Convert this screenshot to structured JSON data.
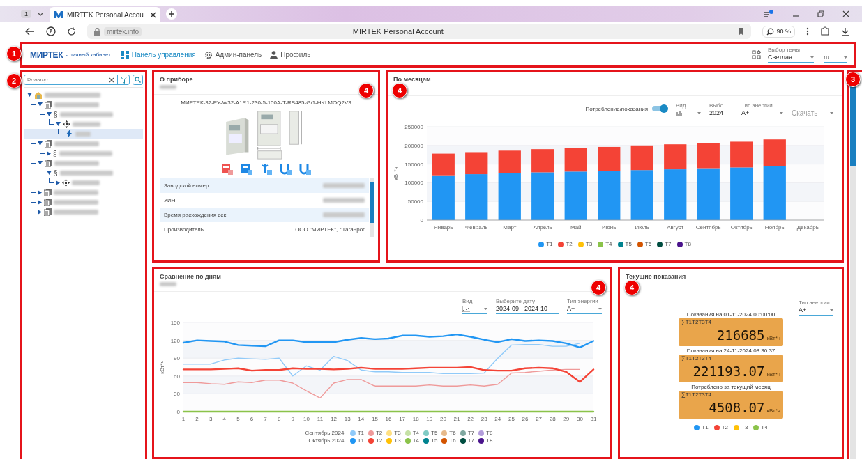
{
  "browser": {
    "tab_count": "1",
    "tab_title": "MIRTEK Personal Accou",
    "address": "mirtek.info",
    "page_title": "MIRTEK Personal Account",
    "zoom": "90 %"
  },
  "header": {
    "badge": "1",
    "logo": "МИРТЕК",
    "logo_tagline": "- личный кабинет",
    "nav": [
      {
        "label": "Панель управления",
        "selected": true
      },
      {
        "label": "Админ-панель",
        "selected": false
      },
      {
        "label": "Профиль",
        "selected": false
      }
    ],
    "theme": {
      "label": "Выбор темы",
      "value": "Светлая"
    },
    "language": {
      "value": "ru"
    }
  },
  "sidebar": {
    "badge": "2",
    "filter": {
      "placeholder": "Фильтр"
    },
    "tree": [
      {
        "kind": "building",
        "expanded": true,
        "selected": false,
        "children": [
          {
            "kind": "contract",
            "expanded": true,
            "selected": false,
            "children": [
              {
                "kind": "section",
                "symbol": "§",
                "expanded": true,
                "selected": false,
                "children": [
                  {
                    "kind": "point",
                    "expanded": true,
                    "selected": false,
                    "children": [
                      {
                        "kind": "meter",
                        "selected": true
                      }
                    ]
                  }
                ]
              }
            ]
          },
          {
            "kind": "contract",
            "expanded": true,
            "selected": false,
            "children": [
              {
                "kind": "section",
                "symbol": "§",
                "expanded": false,
                "selected": false
              }
            ]
          },
          {
            "kind": "contract",
            "expanded": true,
            "selected": false,
            "children": [
              {
                "kind": "section",
                "symbol": "§",
                "expanded": true,
                "selected": false,
                "children": [
                  {
                    "kind": "point",
                    "expanded": false,
                    "selected": false
                  }
                ]
              }
            ]
          },
          {
            "kind": "contract",
            "expanded": false,
            "selected": false
          },
          {
            "kind": "contract",
            "expanded": false,
            "selected": false
          },
          {
            "kind": "contract",
            "expanded": false,
            "selected": false
          }
        ]
      }
    ]
  },
  "scroll_region": {
    "badge": "3"
  },
  "device_card": {
    "badge": "4",
    "title": "О приборе",
    "model": "МИРТЕК-32-РУ-W32-A1R1-230-5-100A-T-RS485-G/1-HKLMOQ2V3",
    "properties": [
      {
        "label": "Заводской номер"
      },
      {
        "label": "УИН"
      },
      {
        "label": "Время расхождения сек."
      },
      {
        "label": "Производитель",
        "value": "ООО \"МИРТЕК\", г.Таганрог"
      }
    ]
  },
  "monthly_card": {
    "badge": "4",
    "title": "По месяцам",
    "controls": [
      {
        "kind": "toggle",
        "label": "Потребление/показания",
        "on": true
      },
      {
        "kind": "view",
        "label": "Вид"
      },
      {
        "kind": "input",
        "label": "Выбо...",
        "value": "2024"
      },
      {
        "kind": "select",
        "label": "Тип энергии",
        "value": "A+"
      },
      {
        "kind": "select",
        "placeholder": "Скачать"
      }
    ],
    "chart_data": {
      "type": "bar",
      "stacked": true,
      "grid": true,
      "ylabel": "кВт*ч",
      "categories": [
        "Январь",
        "Февраль",
        "Март",
        "Апрель",
        "Май",
        "Июнь",
        "Июль",
        "Август",
        "Сентябрь",
        "Октябрь",
        "Ноябрь",
        "Декабрь"
      ],
      "ylim": [
        0,
        250000
      ],
      "yticks": [
        0,
        50000,
        100000,
        150000,
        200000,
        250000
      ],
      "series": [
        {
          "name": "T1",
          "color": "#2196f3",
          "values": [
            120000,
            123000,
            126000,
            128000,
            130000,
            132000,
            134000,
            136000,
            139000,
            141000,
            145000,
            null
          ]
        },
        {
          "name": "T2",
          "color": "#f44336",
          "values": [
            58000,
            59000,
            60000,
            62000,
            63000,
            64000,
            66000,
            67000,
            67000,
            69000,
            71000,
            null
          ]
        },
        {
          "name": "T3",
          "color": "#ffc107",
          "values": [
            null,
            null,
            null,
            null,
            null,
            null,
            null,
            null,
            null,
            null,
            null,
            null
          ]
        },
        {
          "name": "T4",
          "color": "#8bc34a",
          "values": [
            null,
            null,
            null,
            null,
            null,
            null,
            null,
            null,
            null,
            null,
            null,
            null
          ]
        },
        {
          "name": "T5",
          "color": "#00838f",
          "values": [
            null,
            null,
            null,
            null,
            null,
            null,
            null,
            null,
            null,
            null,
            null,
            null
          ]
        },
        {
          "name": "T6",
          "color": "#d35400",
          "values": [
            null,
            null,
            null,
            null,
            null,
            null,
            null,
            null,
            null,
            null,
            null,
            null
          ]
        },
        {
          "name": "T7",
          "color": "#004d40",
          "values": [
            null,
            null,
            null,
            null,
            null,
            null,
            null,
            null,
            null,
            null,
            null,
            null
          ]
        },
        {
          "name": "T8",
          "color": "#4a148c",
          "values": [
            null,
            null,
            null,
            null,
            null,
            null,
            null,
            null,
            null,
            null,
            null,
            null
          ]
        }
      ]
    }
  },
  "daily_card": {
    "badge": "4",
    "title": "Сравнение по дням",
    "controls": [
      {
        "kind": "view",
        "label": "Вид"
      },
      {
        "kind": "input",
        "label": "Выберите дату",
        "value": "2024-09 - 2024-10"
      },
      {
        "kind": "select",
        "label": "Тип энергии",
        "value": "A+"
      }
    ],
    "legend_groups": [
      "Сентябрь 2024:",
      "Октябрь 2024:"
    ],
    "chart_data": {
      "type": "line",
      "grid": true,
      "ylabel": "кВт*ч",
      "x": [
        1,
        2,
        3,
        4,
        5,
        6,
        7,
        8,
        9,
        10,
        11,
        12,
        13,
        14,
        15,
        16,
        17,
        18,
        19,
        20,
        21,
        22,
        23,
        24,
        25,
        26,
        27,
        28,
        29,
        30,
        31
      ],
      "xlim": [
        1,
        31
      ],
      "xticks": [
        1,
        2,
        3,
        4,
        5,
        6,
        7,
        8,
        9,
        10,
        11,
        12,
        13,
        14,
        15,
        16,
        17,
        18,
        19,
        20,
        21,
        22,
        23,
        24,
        25,
        26,
        27,
        28,
        29,
        30,
        31
      ],
      "ylim": [
        0,
        150
      ],
      "yticks": [
        0,
        30,
        60,
        90,
        120,
        150
      ],
      "series": [
        {
          "name": "T1",
          "color": "#90caf9",
          "values": [
            80,
            80,
            80,
            87,
            90,
            89,
            88,
            90,
            60,
            77,
            70,
            93,
            86,
            70,
            67,
            67,
            66,
            66,
            66,
            64,
            64,
            64,
            65,
            90,
            112,
            113,
            113,
            110,
            110,
            115,
            null
          ]
        },
        {
          "name": "T2",
          "color": "#ef9a9a",
          "values": [
            49,
            49,
            47,
            46,
            50,
            49,
            53,
            53,
            48,
            35,
            23,
            48,
            54,
            54,
            43,
            43,
            43,
            43,
            45,
            43,
            43,
            45,
            43,
            46,
            65,
            66,
            68,
            70,
            71,
            71,
            null
          ]
        },
        {
          "name": "T3",
          "color": "#ffe082",
          "values": [
            null,
            null,
            null,
            null,
            null,
            null,
            null,
            null,
            null,
            null,
            null,
            null,
            null,
            null,
            null,
            null,
            null,
            null,
            null,
            null,
            null,
            null,
            null,
            null,
            null,
            null,
            null,
            null,
            null,
            null,
            null
          ]
        },
        {
          "name": "T4",
          "color": "#c5e1a5",
          "values": [
            null,
            null,
            null,
            null,
            null,
            null,
            null,
            null,
            null,
            null,
            null,
            null,
            null,
            null,
            null,
            null,
            null,
            null,
            null,
            null,
            null,
            null,
            null,
            null,
            null,
            null,
            null,
            null,
            null,
            null,
            null
          ]
        },
        {
          "name": "T5",
          "color": "#80cbc4",
          "values": [
            null,
            null,
            null,
            null,
            null,
            null,
            null,
            null,
            null,
            null,
            null,
            null,
            null,
            null,
            null,
            null,
            null,
            null,
            null,
            null,
            null,
            null,
            null,
            null,
            null,
            null,
            null,
            null,
            null,
            null,
            null
          ]
        },
        {
          "name": "T6",
          "color": "#e6b98a",
          "values": [
            null,
            null,
            null,
            null,
            null,
            null,
            null,
            null,
            null,
            null,
            null,
            null,
            null,
            null,
            null,
            null,
            null,
            null,
            null,
            null,
            null,
            null,
            null,
            null,
            null,
            null,
            null,
            null,
            null,
            null,
            null
          ]
        },
        {
          "name": "T7",
          "color": "#80a8a0",
          "values": [
            null,
            null,
            null,
            null,
            null,
            null,
            null,
            null,
            null,
            null,
            null,
            null,
            null,
            null,
            null,
            null,
            null,
            null,
            null,
            null,
            null,
            null,
            null,
            null,
            null,
            null,
            null,
            null,
            null,
            null,
            null
          ]
        },
        {
          "name": "T8",
          "color": "#b39ddb",
          "values": [
            null,
            null,
            null,
            null,
            null,
            null,
            null,
            null,
            null,
            null,
            null,
            null,
            null,
            null,
            null,
            null,
            null,
            null,
            null,
            null,
            null,
            null,
            null,
            null,
            null,
            null,
            null,
            null,
            null,
            null,
            null
          ]
        },
        {
          "name": "T1",
          "color": "#2196f3",
          "values": [
            116,
            120,
            119,
            118,
            112,
            111,
            110,
            120,
            120,
            117,
            117,
            117,
            121,
            124,
            122,
            123,
            128,
            128,
            126,
            127,
            130,
            126,
            121,
            117,
            122,
            119,
            120,
            119,
            115,
            108,
            119
          ]
        },
        {
          "name": "T2",
          "color": "#f44336",
          "values": [
            71,
            71,
            71,
            72,
            73,
            69,
            70,
            70,
            73,
            72,
            72,
            71,
            72,
            74,
            72,
            72,
            72,
            73,
            74,
            74,
            74,
            75,
            70,
            69,
            69,
            73,
            74,
            73,
            67,
            50,
            71
          ]
        },
        {
          "name": "T3",
          "color": "#ffc107",
          "values": [
            null,
            null,
            null,
            null,
            null,
            null,
            null,
            null,
            null,
            null,
            null,
            null,
            null,
            null,
            null,
            null,
            null,
            null,
            null,
            null,
            null,
            null,
            null,
            null,
            null,
            null,
            null,
            null,
            null,
            null,
            null
          ]
        },
        {
          "name": "T4",
          "color": "#8bc34a",
          "values": [
            0,
            0,
            0,
            0,
            0,
            0,
            0,
            0,
            0,
            0,
            0,
            0,
            0,
            0,
            0,
            0,
            0,
            0,
            0,
            0,
            0,
            0,
            0,
            0,
            0,
            0,
            0,
            0,
            0,
            0,
            0
          ]
        },
        {
          "name": "T5",
          "color": "#00838f",
          "values": [
            null,
            null,
            null,
            null,
            null,
            null,
            null,
            null,
            null,
            null,
            null,
            null,
            null,
            null,
            null,
            null,
            null,
            null,
            null,
            null,
            null,
            null,
            null,
            null,
            null,
            null,
            null,
            null,
            null,
            null,
            null
          ]
        },
        {
          "name": "T6",
          "color": "#d35400",
          "values": [
            null,
            null,
            null,
            null,
            null,
            null,
            null,
            null,
            null,
            null,
            null,
            null,
            null,
            null,
            null,
            null,
            null,
            null,
            null,
            null,
            null,
            null,
            null,
            null,
            null,
            null,
            null,
            null,
            null,
            null,
            null
          ]
        },
        {
          "name": "T7",
          "color": "#004d40",
          "values": [
            null,
            null,
            null,
            null,
            null,
            null,
            null,
            null,
            null,
            null,
            null,
            null,
            null,
            null,
            null,
            null,
            null,
            null,
            null,
            null,
            null,
            null,
            null,
            null,
            null,
            null,
            null,
            null,
            null,
            null,
            null
          ]
        },
        {
          "name": "T8",
          "color": "#4a148c",
          "values": [
            null,
            null,
            null,
            null,
            null,
            null,
            null,
            null,
            null,
            null,
            null,
            null,
            null,
            null,
            null,
            null,
            null,
            null,
            null,
            null,
            null,
            null,
            null,
            null,
            null,
            null,
            null,
            null,
            null,
            null,
            null
          ]
        }
      ]
    }
  },
  "current_card": {
    "badge": "4",
    "title": "Текущие показания",
    "controls": [
      {
        "kind": "select",
        "label": "Тип энергии",
        "value": "A+"
      }
    ],
    "readings": [
      {
        "label": "Показания на 01-11-2024 00:00:00",
        "tariffs": "∑T1T2T3T4",
        "value": "216685",
        "unit": "кВт*ч"
      },
      {
        "label": "Показания на 24-11-2024 08:30:37",
        "tariffs": "∑T1T2T3T4",
        "value": "221193.07",
        "unit": "кВт*ч"
      },
      {
        "label": "Потреблено за текущий месяц",
        "tariffs": "∑T1T2T3T4",
        "value": "4508.07",
        "unit": "кВт*ч"
      }
    ],
    "legend": [
      {
        "name": "T1",
        "color": "#2196f3"
      },
      {
        "name": "T2",
        "color": "#f44336"
      },
      {
        "name": "T3",
        "color": "#ffc107"
      },
      {
        "name": "T4",
        "color": "#8bc34a"
      }
    ]
  }
}
